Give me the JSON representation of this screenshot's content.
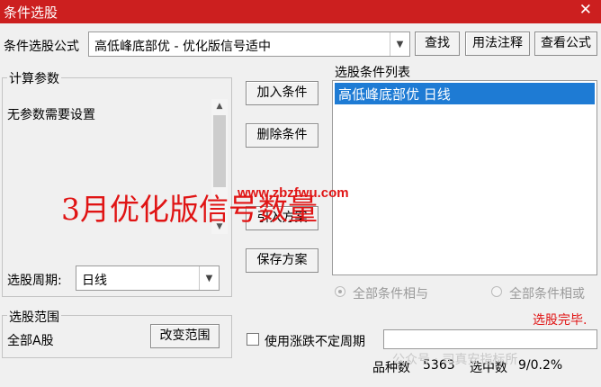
{
  "window": {
    "title": "条件选股",
    "close_glyph": "✕"
  },
  "formula": {
    "label": "条件选股公式",
    "value": "高低峰底部优  -  优化版信号适中",
    "buttons": {
      "find": "查找",
      "usage": "用法注释",
      "view": "查看公式"
    }
  },
  "params": {
    "group_title": "计算参数",
    "text": "无参数需要设置"
  },
  "period": {
    "label": "选股周期:",
    "value": "日线"
  },
  "actions": {
    "add": "加入条件",
    "delete": "删除条件",
    "import": "引入方案",
    "save": "保存方案"
  },
  "conditions": {
    "title": "选股条件列表",
    "items": [
      "高低峰底部优  日线"
    ]
  },
  "logic": {
    "and_label": "全部条件相与",
    "or_label": "全部条件相或",
    "selected": "and"
  },
  "status": {
    "done": "选股完毕."
  },
  "range": {
    "group_title": "选股范围",
    "value": "全部A股",
    "change_button": "改变范围"
  },
  "volatile_period": {
    "label": "使用涨跌不定周期",
    "checked": false,
    "value": ""
  },
  "stats": {
    "total_label": "品种数",
    "total": "5363",
    "selected_label": "选中数",
    "selected": "9/0.2%"
  },
  "overlay": {
    "headline": "3月优化版信号数量",
    "url": "www.zbzfwu.com",
    "watermark": "公众号 · 司真安指标所"
  },
  "colors": {
    "title_bar": "#cc1f1f",
    "selection": "#1e7bd4",
    "alert": "#e01414"
  }
}
